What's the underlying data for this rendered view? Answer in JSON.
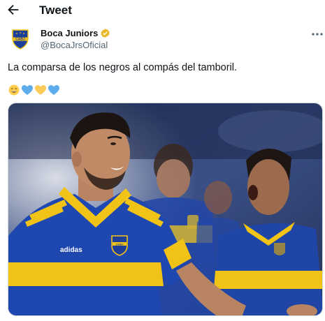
{
  "header": {
    "title": "Tweet",
    "back_icon": "arrow-left-icon"
  },
  "author": {
    "display_name": "Boca Juniors",
    "handle": "@BocaJrsOficial",
    "avatar_icon": "club-crest-icon",
    "avatar_text": "CABJ",
    "verified_icon": "verified-gold-badge-icon",
    "more_icon": "more-horizontal-icon"
  },
  "tweet": {
    "text": "La comparsa de los negros al compás del tamboril.",
    "emojis": [
      "grinning-face-emoji",
      "blue-heart-emoji",
      "yellow-heart-emoji",
      "blue-heart-emoji"
    ],
    "media": {
      "type": "photo",
      "crest_text": "CABJ",
      "sponsor_text": "adidas"
    }
  },
  "colors": {
    "boca_blue": "#1d3f9a",
    "boca_gold": "#f2c317",
    "verified_gold": "#e8b829",
    "text_primary": "#0f1419",
    "text_secondary": "#536471"
  }
}
